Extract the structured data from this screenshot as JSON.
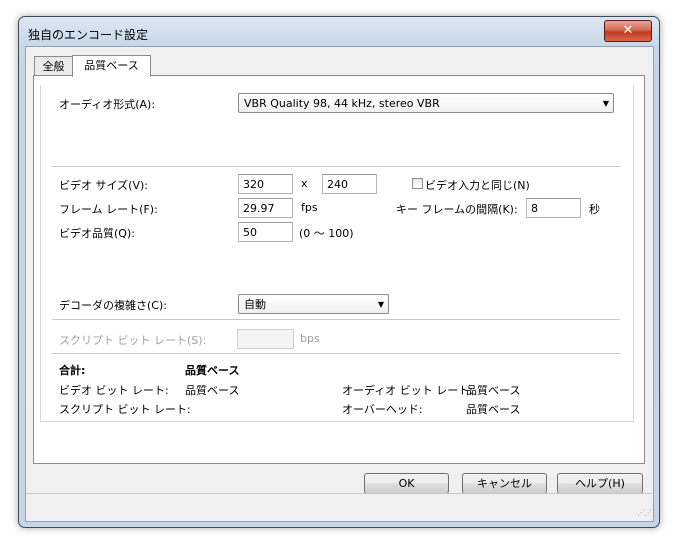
{
  "window": {
    "title": "独自のエンコード設定",
    "close_glyph": "✕"
  },
  "tabs": [
    {
      "label": "全般"
    },
    {
      "label": "品質ベース"
    }
  ],
  "audio": {
    "label": "オーディオ形式(A):",
    "value": "VBR Quality 98, 44 kHz, stereo VBR"
  },
  "video": {
    "size_label": "ビデオ サイズ(V):",
    "width": "320",
    "times": "x",
    "height": "240",
    "same_as_input_label": "ビデオ入力と同じ(N)",
    "framerate_label": "フレーム レート(F):",
    "framerate": "29.97",
    "fps_unit": "fps",
    "keyframe_label": "キー フレームの間隔(K):",
    "keyframe": "8",
    "sec_unit": "秒",
    "quality_label": "ビデオ品質(Q):",
    "quality": "50",
    "quality_range": "(0 ～ 100)"
  },
  "decoder": {
    "label": "デコーダの複雑さ(C):",
    "value": "自動"
  },
  "script": {
    "label": "スクリプト ビット レート(S):",
    "value": "",
    "unit": "bps"
  },
  "summary": {
    "total_label": "合計:",
    "total_value": "品質ベース",
    "video_bitrate_label": "ビデオ ビット レート:",
    "video_bitrate_value": "品質ベース",
    "audio_bitrate_label": "オーディオ ビット レート:",
    "audio_bitrate_value": "品質ベース",
    "script_bitrate_label": "スクリプト ビット レート:",
    "overhead_label": "オーバーヘッド:",
    "overhead_value": "品質ベース"
  },
  "buttons": {
    "ok": "OK",
    "cancel": "キャンセル",
    "help": "ヘルプ(H)"
  },
  "colors": {
    "close": "#c8432a",
    "frame": "#c7d5e4"
  }
}
